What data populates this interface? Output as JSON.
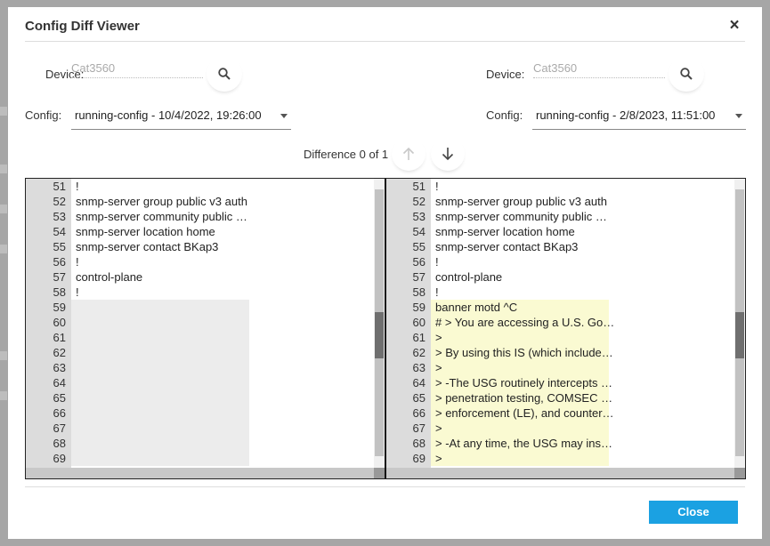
{
  "dialog": {
    "title": "Config Diff Viewer",
    "close_icon": "×",
    "close_button_label": "Close"
  },
  "left": {
    "device_label": "Device:",
    "device_placeholder": "Cat3560",
    "config_label": "Config:",
    "config_value": "running-config - 10/4/2022, 19:26:00"
  },
  "right": {
    "device_label": "Device:",
    "device_placeholder": "Cat3560",
    "config_label": "Config:",
    "config_value": "running-config - 2/8/2023, 11:51:00"
  },
  "diff_nav": {
    "label": "Difference 0 of 1"
  },
  "left_lines": [
    {
      "num": "51",
      "text": "!",
      "mark": ""
    },
    {
      "num": "52",
      "text": "snmp-server group public v3 auth",
      "mark": ""
    },
    {
      "num": "53",
      "text": "snmp-server community public …",
      "mark": ""
    },
    {
      "num": "54",
      "text": "snmp-server location home",
      "mark": ""
    },
    {
      "num": "55",
      "text": "snmp-server contact BKap3",
      "mark": ""
    },
    {
      "num": "56",
      "text": "!",
      "mark": ""
    },
    {
      "num": "57",
      "text": "control-plane",
      "mark": ""
    },
    {
      "num": "58",
      "text": "!",
      "mark": ""
    },
    {
      "num": "59",
      "text": "",
      "mark": "empty"
    },
    {
      "num": "60",
      "text": "",
      "mark": "empty"
    },
    {
      "num": "61",
      "text": "",
      "mark": "empty"
    },
    {
      "num": "62",
      "text": "",
      "mark": "empty"
    },
    {
      "num": "63",
      "text": "",
      "mark": "empty"
    },
    {
      "num": "64",
      "text": "",
      "mark": "empty"
    },
    {
      "num": "65",
      "text": "",
      "mark": "empty"
    },
    {
      "num": "66",
      "text": "",
      "mark": "empty"
    },
    {
      "num": "67",
      "text": "",
      "mark": "empty"
    },
    {
      "num": "68",
      "text": "",
      "mark": "empty"
    },
    {
      "num": "69",
      "text": "",
      "mark": "empty"
    }
  ],
  "right_lines": [
    {
      "num": "51",
      "text": "!",
      "mark": ""
    },
    {
      "num": "52",
      "text": "snmp-server group public v3 auth",
      "mark": ""
    },
    {
      "num": "53",
      "text": "snmp-server community public …",
      "mark": ""
    },
    {
      "num": "54",
      "text": "snmp-server location home",
      "mark": ""
    },
    {
      "num": "55",
      "text": "snmp-server contact BKap3",
      "mark": ""
    },
    {
      "num": "56",
      "text": "!",
      "mark": ""
    },
    {
      "num": "57",
      "text": "control-plane",
      "mark": ""
    },
    {
      "num": "58",
      "text": "!",
      "mark": ""
    },
    {
      "num": "59",
      "text": "banner motd ^C",
      "mark": "added"
    },
    {
      "num": "60",
      "text": "# > You are accessing a U.S. Go…",
      "mark": "added"
    },
    {
      "num": "61",
      "text": ">",
      "mark": "added"
    },
    {
      "num": "62",
      "text": "> By using this IS (which include…",
      "mark": "added"
    },
    {
      "num": "63",
      "text": ">",
      "mark": "added"
    },
    {
      "num": "64",
      "text": "> -The USG routinely intercepts …",
      "mark": "added"
    },
    {
      "num": "65",
      "text": "> penetration testing, COMSEC …",
      "mark": "added"
    },
    {
      "num": "66",
      "text": "> enforcement (LE), and counter…",
      "mark": "added"
    },
    {
      "num": "67",
      "text": ">",
      "mark": "added"
    },
    {
      "num": "68",
      "text": "> -At any time, the USG may ins…",
      "mark": "added"
    },
    {
      "num": "69",
      "text": ">",
      "mark": "added"
    }
  ],
  "colors": {
    "accent": "#1ba1e2",
    "added_line": "#fafad2",
    "empty_line": "#ececec",
    "gutter": "#dcdcdc"
  },
  "icons": {
    "search": "search-icon",
    "up": "arrow-up-icon",
    "down": "arrow-down-icon",
    "close": "close-icon",
    "caret": "caret-down-icon"
  }
}
